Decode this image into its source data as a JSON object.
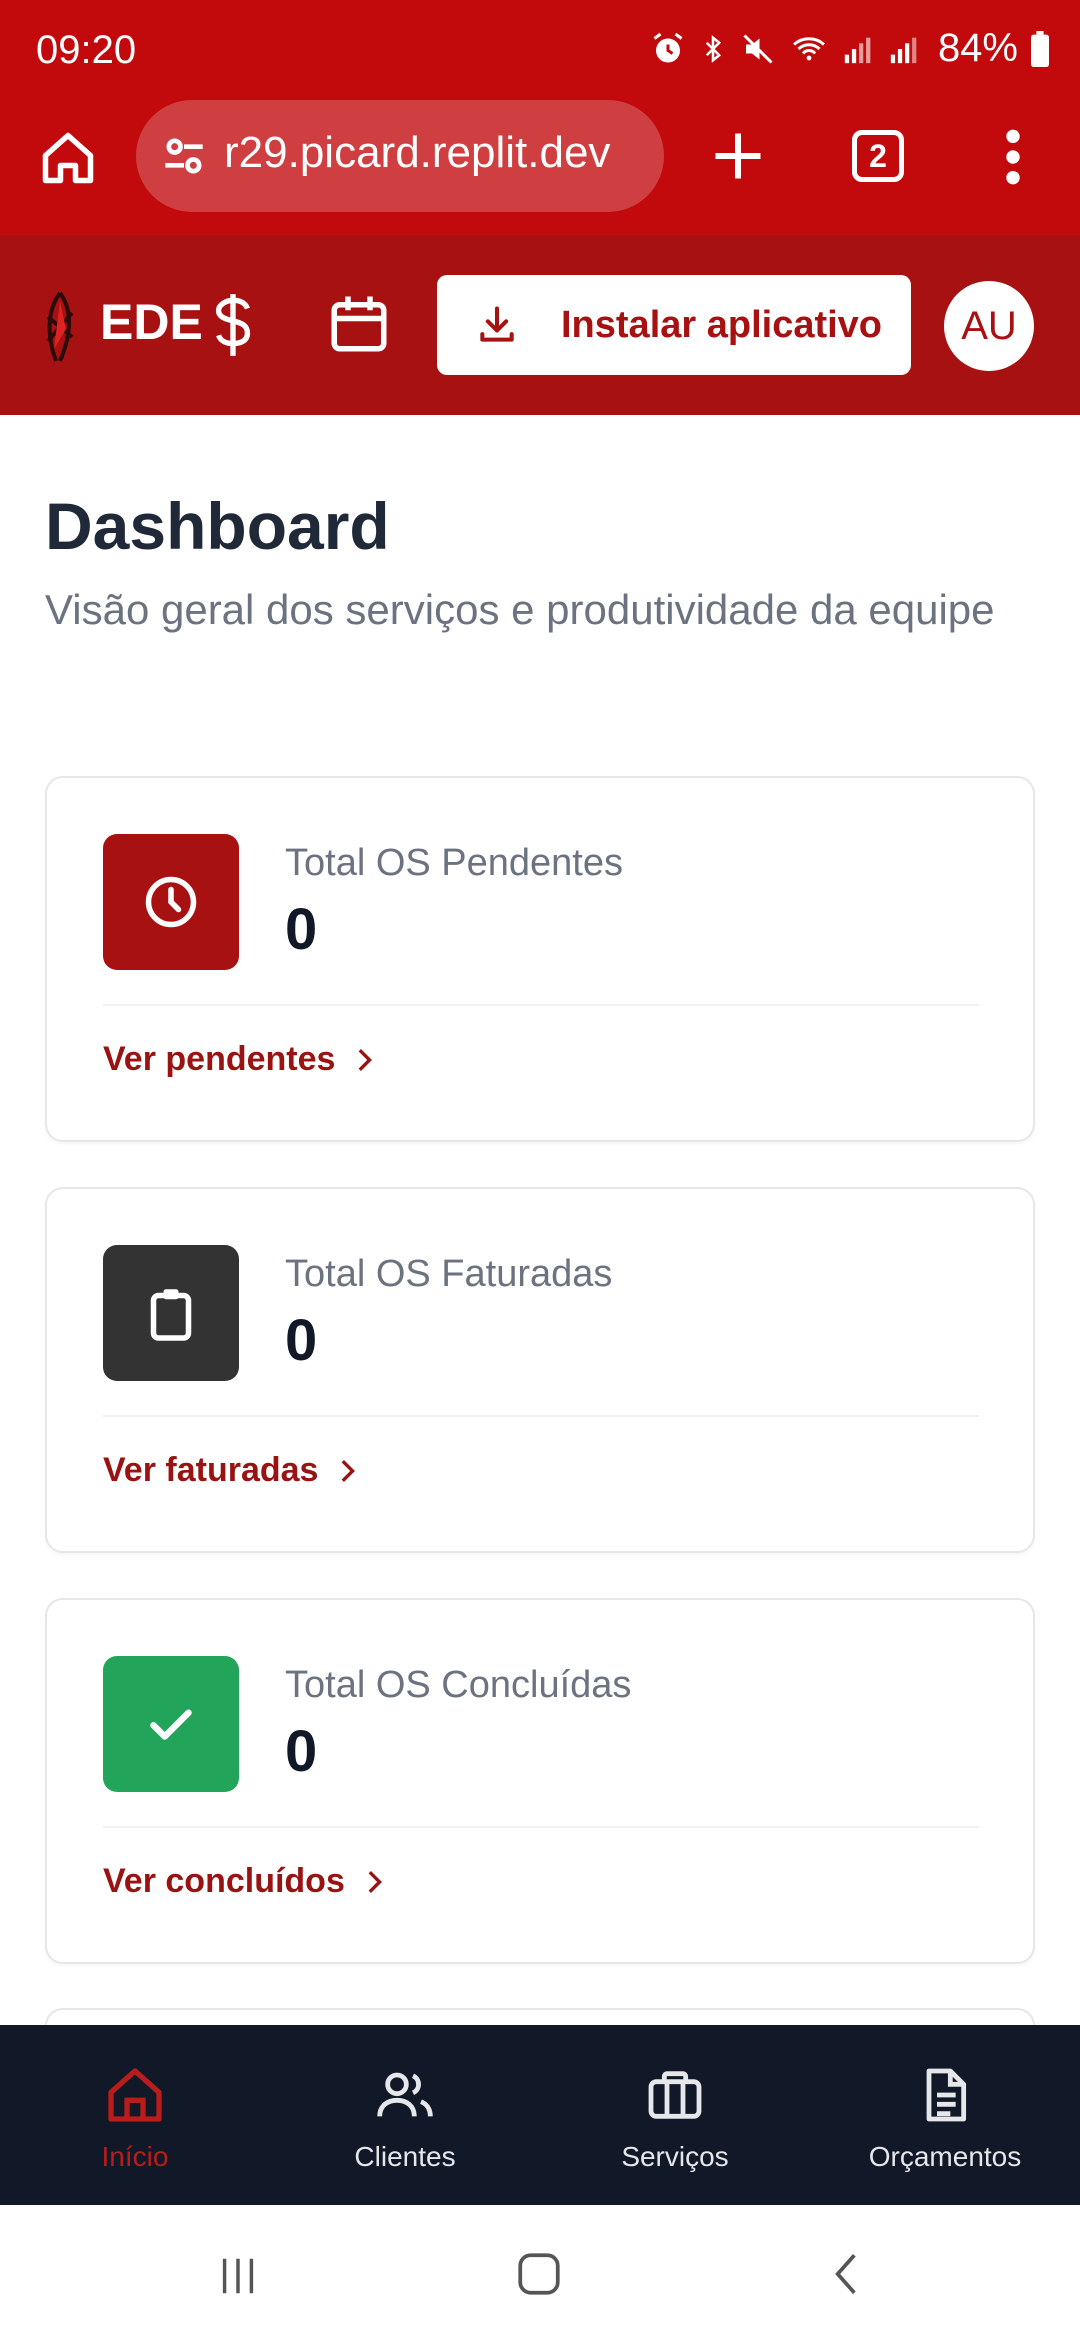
{
  "status_bar": {
    "time": "09:20",
    "battery": "84%"
  },
  "browser": {
    "url": "r29.picard.replit.dev",
    "tab_count": "2"
  },
  "header": {
    "brand": "EDE",
    "install_label": "Instalar aplicativo",
    "avatar_initials": "AU"
  },
  "page": {
    "title": "Dashboard",
    "subtitle": "Visão geral dos serviços e produtividade da equipe"
  },
  "cards": [
    {
      "label": "Total OS Pendentes",
      "value": "0",
      "link": "Ver pendentes",
      "icon": "clock-icon",
      "color": "#a81111"
    },
    {
      "label": "Total OS Faturadas",
      "value": "0",
      "link": "Ver faturadas",
      "icon": "clipboard-icon",
      "color": "#333333"
    },
    {
      "label": "Total OS Concluídas",
      "value": "0",
      "link": "Ver concluídos",
      "icon": "check-icon",
      "color": "#22a55a"
    }
  ],
  "bottom_nav": {
    "items": [
      {
        "label": "Início",
        "icon": "home-icon",
        "active": true
      },
      {
        "label": "Clientes",
        "icon": "users-icon"
      },
      {
        "label": "Serviços",
        "icon": "briefcase-icon"
      },
      {
        "label": "Orçamentos",
        "icon": "document-icon"
      }
    ]
  },
  "colors": {
    "status_bar": "#c20a0c",
    "header": "#a81111",
    "nav_bg": "#111827",
    "accent": "#9a1313"
  }
}
